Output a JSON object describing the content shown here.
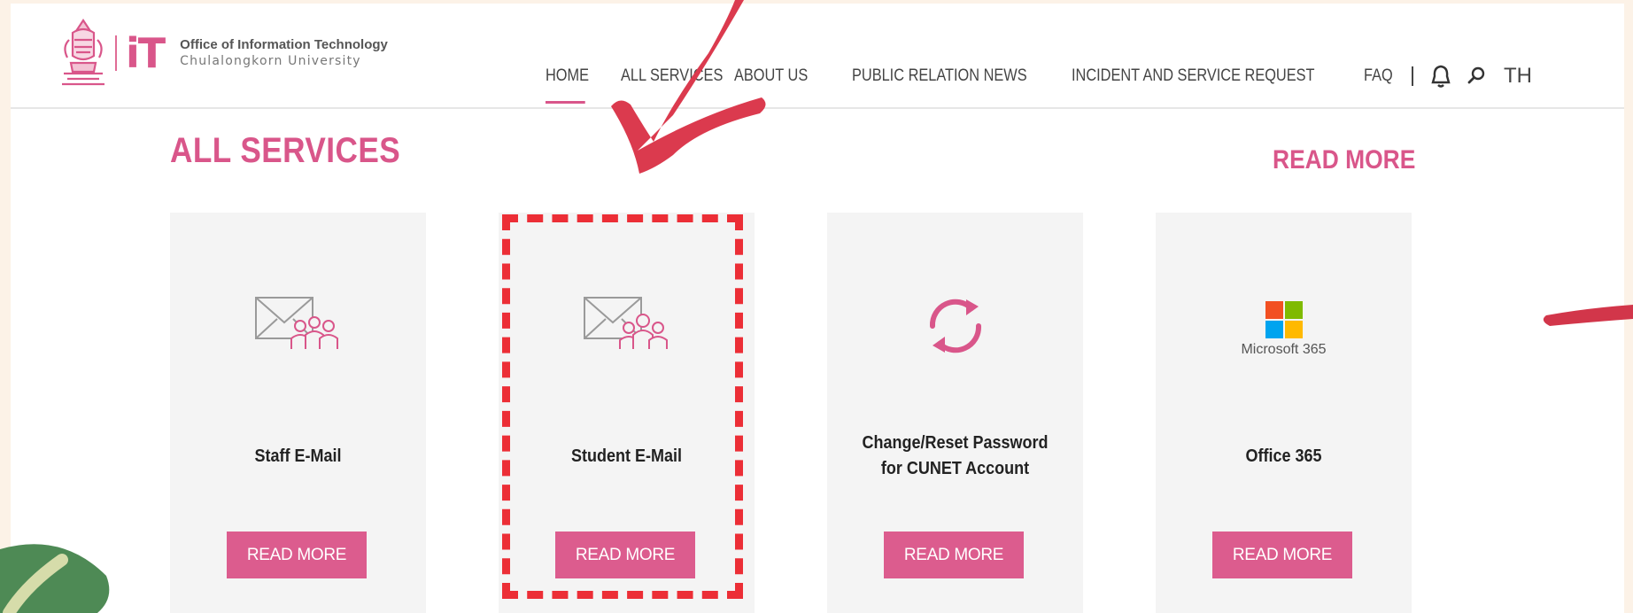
{
  "header": {
    "org_line1": "Office of Information Technology",
    "org_line2": "Chulalongkorn University",
    "it_mark": "iT",
    "nav": [
      {
        "label": "HOME",
        "active": true
      },
      {
        "label": "ALL SERVICES",
        "active": false
      },
      {
        "label": "ABOUT US",
        "active": false
      },
      {
        "label": "PUBLIC RELATION NEWS",
        "active": false
      },
      {
        "label": "INCIDENT AND SERVICE REQUEST",
        "active": false
      },
      {
        "label": "FAQ",
        "active": false
      }
    ],
    "bell_icon": "bell-icon",
    "search_icon": "search-icon",
    "language": "TH"
  },
  "section": {
    "title": "ALL SERVICES",
    "read_more": "READ MORE"
  },
  "cards": [
    {
      "name": "Staff E-Mail",
      "icon": "envelope-people-icon",
      "button": "READ MORE"
    },
    {
      "name": "Student E-Mail",
      "icon": "envelope-people-icon",
      "button": "READ MORE"
    },
    {
      "name_line1": "Change/Reset Password",
      "name_line2": "for CUNET Account",
      "icon": "refresh-icon",
      "button": "READ MORE"
    },
    {
      "name": "Office 365",
      "icon": "microsoft-365-logo",
      "logo_text": "Microsoft 365",
      "button": "READ MORE"
    }
  ],
  "colors": {
    "brand_pink": "#d9568a",
    "button_pink": "#dc5c8e",
    "annotation_red": "#ec2e36",
    "arrow_red": "#db3a4e",
    "background": "#fcf2e7",
    "card_bg": "#f4f4f4"
  },
  "annotation": {
    "highlight": "Student E-Mail card",
    "arrow_icon": "arrow-icon"
  }
}
